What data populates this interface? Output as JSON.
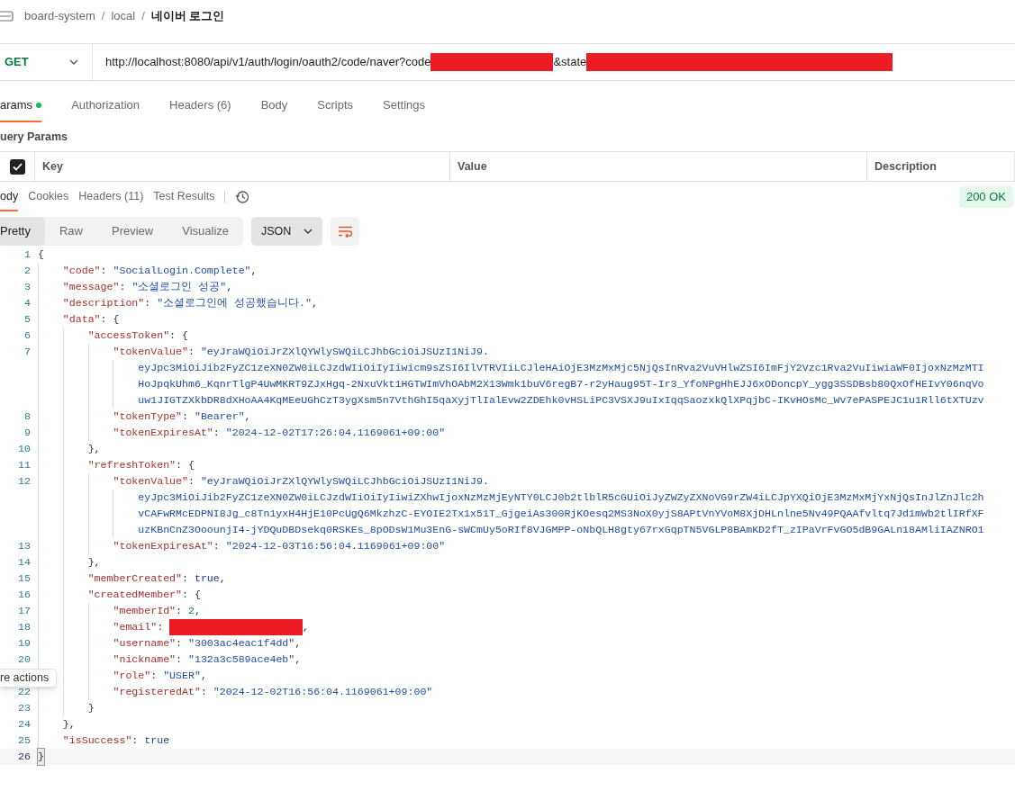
{
  "breadcrumb": [
    {
      "kind": "crumb",
      "text": "board-system"
    },
    {
      "kind": "sep",
      "text": "/"
    },
    {
      "kind": "crumb",
      "text": "local"
    },
    {
      "kind": "sep",
      "text": "/"
    },
    {
      "kind": "current",
      "text": "네이버 로그인"
    }
  ],
  "request": {
    "method": "GET",
    "url_parts": [
      {
        "kind": "text",
        "text": "http://localhost:8080/api/v1/auth/login/oauth2/code/naver?code"
      },
      {
        "kind": "redacted"
      },
      {
        "kind": "text",
        "text": "&state"
      },
      {
        "kind": "redacted"
      }
    ]
  },
  "request_tabs": [
    {
      "label": "arams",
      "selected": true,
      "dot": true
    },
    {
      "label": "Authorization",
      "selected": false,
      "dot": false
    },
    {
      "label": "Headers (6)",
      "selected": false,
      "dot": false
    },
    {
      "label": "Body",
      "selected": false,
      "dot": false
    },
    {
      "label": "Scripts",
      "selected": false,
      "dot": false
    },
    {
      "label": "Settings",
      "selected": false,
      "dot": false
    }
  ],
  "query_params": {
    "title": "uery Params",
    "select_all_checked": true,
    "columns": [
      "Key",
      "Value",
      "Description"
    ]
  },
  "response_tabs": [
    {
      "label": "ody",
      "selected": true
    },
    {
      "label": "Cookies",
      "selected": false
    },
    {
      "label": "Headers (11)",
      "selected": false
    },
    {
      "label": "Test Results",
      "selected": false
    }
  ],
  "status": "200 OK",
  "view_modes": [
    {
      "label": "Pretty",
      "selected": true
    },
    {
      "label": "Raw",
      "selected": false
    },
    {
      "label": "Preview",
      "selected": false
    },
    {
      "label": "Visualize",
      "selected": false
    }
  ],
  "format": "JSON",
  "code_lines": [
    {
      "number": "1",
      "current": false,
      "tokens": [
        {
          "kind": "punct",
          "text": "{"
        }
      ]
    },
    {
      "number": "2",
      "current": false,
      "tokens": [
        {
          "kind": "key",
          "text": "    \"code\""
        },
        {
          "kind": "punct",
          "text": ": "
        },
        {
          "kind": "string",
          "text": "\"SocialLogin.Complete\""
        },
        {
          "kind": "punct",
          "text": ","
        }
      ]
    },
    {
      "number": "3",
      "current": false,
      "tokens": [
        {
          "kind": "key",
          "text": "    \"message\""
        },
        {
          "kind": "punct",
          "text": ": "
        },
        {
          "kind": "string",
          "text": "\"소셜로그인 성공\""
        },
        {
          "kind": "punct",
          "text": ","
        }
      ]
    },
    {
      "number": "4",
      "current": false,
      "tokens": [
        {
          "kind": "key",
          "text": "    \"description\""
        },
        {
          "kind": "punct",
          "text": ": "
        },
        {
          "kind": "string",
          "text": "\"소셜로그인에 성공했습니다.\""
        },
        {
          "kind": "punct",
          "text": ","
        }
      ]
    },
    {
      "number": "5",
      "current": false,
      "tokens": [
        {
          "kind": "key",
          "text": "    \"data\""
        },
        {
          "kind": "punct",
          "text": ": {"
        }
      ]
    },
    {
      "number": "6",
      "current": false,
      "tokens": [
        {
          "kind": "key",
          "text": "        \"accessToken\""
        },
        {
          "kind": "punct",
          "text": ": {"
        }
      ]
    },
    {
      "number": "7",
      "current": false,
      "tokens": [
        {
          "kind": "key",
          "text": "            \"tokenValue\""
        },
        {
          "kind": "punct",
          "text": ": "
        },
        {
          "kind": "string",
          "text": "\"eyJraWQiOiJrZXlQYWlySWQiLCJhbGciOiJSUzI1NiJ9."
        }
      ]
    },
    {
      "current": false,
      "tokens": [
        {
          "kind": "string",
          "text": "                eyJpc3MiOiJib2FyZC1zeXN0ZW0iLCJzdWIiOiIyIiwicm9sZSI6IlVTRVIiLCJleHAiOjE3MzMxMjc5NjQsInRva2VuVHlwZSI6ImFjY2Vzc1Rva2VuIiwiaWF0IjoxNzMzMTI"
        }
      ]
    },
    {
      "current": false,
      "tokens": [
        {
          "kind": "string",
          "text": "                HoJpqkUhm6_KqnrTlgP4UwMKRT9ZJxHgq-2NxuVkt1HGTWImVhOAbM2X13Wmk1buV6regB7-r2yHaug95T-Ir3_YfoNPgHhEJJ6xODoncpY_ygg3SSDBsb80QxOfHEIvY06nqVo"
        }
      ]
    },
    {
      "current": false,
      "tokens": [
        {
          "kind": "string",
          "text": "                uw1JIGTZXkbDR8dXHoAA4KqMEeUGhCzT3ygXsm5n7VthGhI5qaXyjTlIalEvw2ZDEhk0vHSLiPC3VSXJ9uIxIqqSaozxkQlXPqjbC-IKvHOsMc_Wv7ePASPEJC1u1Rll6tXTUzv"
        }
      ]
    },
    {
      "number": "8",
      "current": false,
      "tokens": [
        {
          "kind": "key",
          "text": "            \"tokenType\""
        },
        {
          "kind": "punct",
          "text": ": "
        },
        {
          "kind": "string",
          "text": "\"Bearer\""
        },
        {
          "kind": "punct",
          "text": ","
        }
      ]
    },
    {
      "number": "9",
      "current": false,
      "tokens": [
        {
          "kind": "key",
          "text": "            \"tokenExpiresAt\""
        },
        {
          "kind": "punct",
          "text": ": "
        },
        {
          "kind": "string",
          "text": "\"2024-12-02T17:26:04.1169061+09:00\""
        }
      ]
    },
    {
      "number": "10",
      "current": false,
      "tokens": [
        {
          "kind": "punct",
          "text": "        },"
        }
      ]
    },
    {
      "number": "11",
      "current": false,
      "tokens": [
        {
          "kind": "key",
          "text": "        \"refreshToken\""
        },
        {
          "kind": "punct",
          "text": ": {"
        }
      ]
    },
    {
      "number": "12",
      "current": false,
      "tokens": [
        {
          "kind": "key",
          "text": "            \"tokenValue\""
        },
        {
          "kind": "punct",
          "text": ": "
        },
        {
          "kind": "string",
          "text": "\"eyJraWQiOiJrZXlQYWlySWQiLCJhbGciOiJSUzI1NiJ9."
        }
      ]
    },
    {
      "current": false,
      "tokens": [
        {
          "kind": "string",
          "text": "                eyJpc3MiOiJib2FyZC1zeXN0ZW0iLCJzdWIiOiIyIiwiZXhwIjoxNzMzMjEyNTY0LCJ0b2tlblR5cGUiOiJyZWZyZXNoVG9rZW4iLCJpYXQiOjE3MzMxMjYxNjQsInJlZnJlc2h"
        }
      ]
    },
    {
      "current": false,
      "tokens": [
        {
          "kind": "string",
          "text": "                vCAFwRMcEDPNI8Jg_c8Tn1yxH4HjE10PcUgQ6MkzhzC-EYOIE2Tx1x51T_GjgeiAs300RjKOesq2MS3NoX0yjS8APtVnYVoM8XjDHLnlne5Nv49PQAAfvltq7Jd1mWb2tlIRfXF"
        }
      ]
    },
    {
      "current": false,
      "tokens": [
        {
          "kind": "string",
          "text": "                uzKBnCnZ3OoounjI4-jYDQuDBDsekq0RSKEs_8pODsW1Mu3EnG-sWCmUy5oRIf8VJGMPP-oNbQLH8gty67rxGqpTN5VGLP8BAmKD2fT_zIPaVrFvGO5dB9GALn18AMliIAZNRO1"
        }
      ]
    },
    {
      "number": "13",
      "current": false,
      "tokens": [
        {
          "kind": "key",
          "text": "            \"tokenExpiresAt\""
        },
        {
          "kind": "punct",
          "text": ": "
        },
        {
          "kind": "string",
          "text": "\"2024-12-03T16:56:04.1169061+09:00\""
        }
      ]
    },
    {
      "number": "14",
      "current": false,
      "tokens": [
        {
          "kind": "punct",
          "text": "        },"
        }
      ]
    },
    {
      "number": "15",
      "current": false,
      "tokens": [
        {
          "kind": "key",
          "text": "        \"memberCreated\""
        },
        {
          "kind": "punct",
          "text": ": "
        },
        {
          "kind": "bool",
          "text": "true"
        },
        {
          "kind": "punct",
          "text": ","
        }
      ]
    },
    {
      "number": "16",
      "current": false,
      "tokens": [
        {
          "kind": "key",
          "text": "        \"createdMember\""
        },
        {
          "kind": "punct",
          "text": ": {"
        }
      ]
    },
    {
      "number": "17",
      "current": false,
      "tokens": [
        {
          "kind": "key",
          "text": "            \"memberId\""
        },
        {
          "kind": "punct",
          "text": ": "
        },
        {
          "kind": "number",
          "text": "2"
        },
        {
          "kind": "punct",
          "text": ","
        }
      ]
    },
    {
      "number": "18",
      "current": false,
      "tokens": [
        {
          "kind": "key",
          "text": "            \"email\""
        },
        {
          "kind": "punct",
          "text": ": "
        },
        {
          "kind": "redacted"
        },
        {
          "kind": "punct",
          "text": ","
        }
      ]
    },
    {
      "number": "19",
      "current": false,
      "tokens": [
        {
          "kind": "key",
          "text": "            \"username\""
        },
        {
          "kind": "punct",
          "text": ": "
        },
        {
          "kind": "string",
          "text": "\"3003ac4eac1f4dd\""
        },
        {
          "kind": "punct",
          "text": ","
        }
      ]
    },
    {
      "number": "20",
      "current": false,
      "tokens": [
        {
          "kind": "key",
          "text": "            \"nickname\""
        },
        {
          "kind": "punct",
          "text": ": "
        },
        {
          "kind": "string",
          "text": "\"132a3c589ace4eb\""
        },
        {
          "kind": "punct",
          "text": ","
        }
      ]
    },
    {
      "current": false,
      "tokens": [
        {
          "kind": "key",
          "text": "            \"role\""
        },
        {
          "kind": "punct",
          "text": ": "
        },
        {
          "kind": "string",
          "text": "\"USER\""
        },
        {
          "kind": "punct",
          "text": ","
        }
      ]
    },
    {
      "number": "22",
      "current": false,
      "tokens": [
        {
          "kind": "key",
          "text": "            \"registeredAt\""
        },
        {
          "kind": "punct",
          "text": ": "
        },
        {
          "kind": "string",
          "text": "\"2024-12-02T16:56:04.1169061+09:00\""
        }
      ]
    },
    {
      "number": "23",
      "current": false,
      "tokens": [
        {
          "kind": "punct",
          "text": "        }"
        }
      ]
    },
    {
      "number": "24",
      "current": false,
      "tokens": [
        {
          "kind": "punct",
          "text": "    },"
        }
      ]
    },
    {
      "number": "25",
      "current": false,
      "tokens": [
        {
          "kind": "key",
          "text": "    \"isSuccess\""
        },
        {
          "kind": "punct",
          "text": ": "
        },
        {
          "kind": "bool",
          "text": "true"
        }
      ]
    },
    {
      "number": "26",
      "current": true,
      "tokens": [
        {
          "kind": "punct",
          "text": "}"
        }
      ]
    }
  ],
  "tooltip": "re actions"
}
